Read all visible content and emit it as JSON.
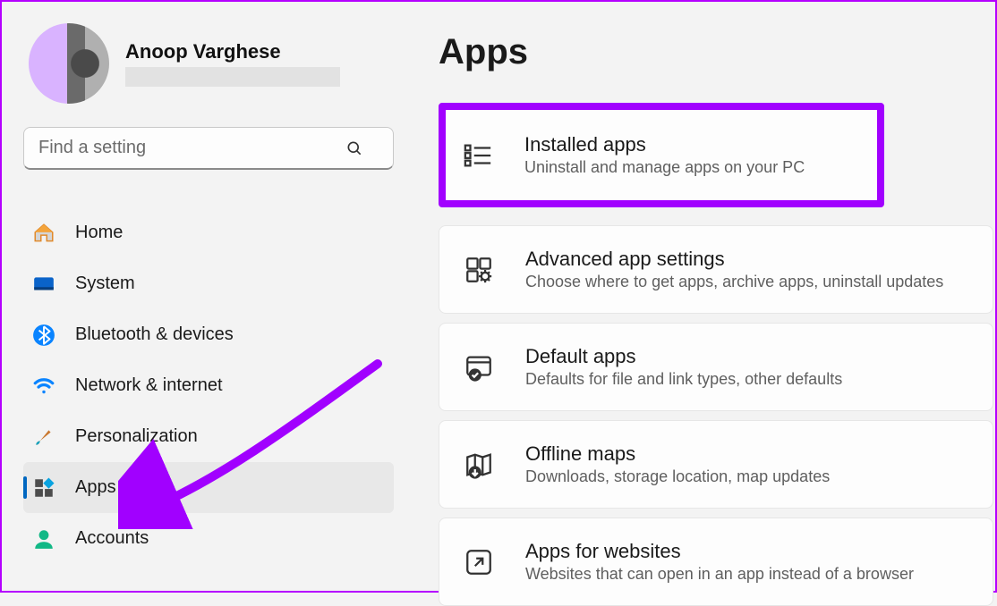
{
  "profile": {
    "name": "Anoop Varghese"
  },
  "search": {
    "placeholder": "Find a setting"
  },
  "sidebar": {
    "items": [
      {
        "label": "Home"
      },
      {
        "label": "System"
      },
      {
        "label": "Bluetooth & devices"
      },
      {
        "label": "Network & internet"
      },
      {
        "label": "Personalization"
      },
      {
        "label": "Apps"
      },
      {
        "label": "Accounts"
      }
    ]
  },
  "main": {
    "title": "Apps",
    "cards": [
      {
        "title": "Installed apps",
        "sub": "Uninstall and manage apps on your PC"
      },
      {
        "title": "Advanced app settings",
        "sub": "Choose where to get apps, archive apps, uninstall updates"
      },
      {
        "title": "Default apps",
        "sub": "Defaults for file and link types, other defaults"
      },
      {
        "title": "Offline maps",
        "sub": "Downloads, storage location, map updates"
      },
      {
        "title": "Apps for websites",
        "sub": "Websites that can open in an app instead of a browser"
      }
    ]
  }
}
